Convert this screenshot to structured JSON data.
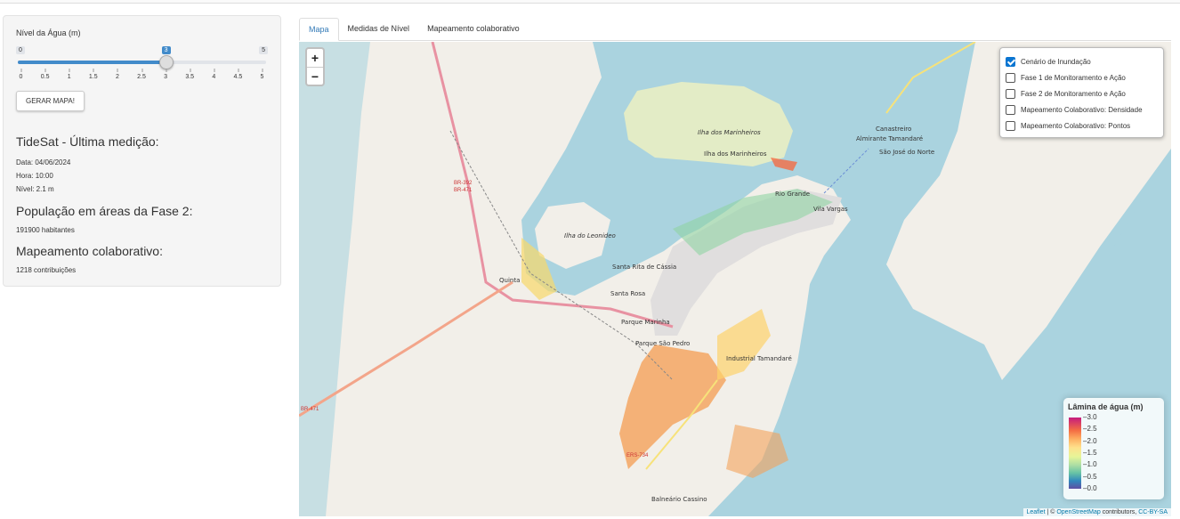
{
  "sidebar": {
    "slider": {
      "label": "Nível da Água (m)",
      "min": "0",
      "max": "5",
      "value": "3",
      "value_num": 3,
      "max_num": 5,
      "ticks": [
        "0",
        "0.5",
        "1",
        "1.5",
        "2",
        "2.5",
        "3",
        "3.5",
        "4",
        "4.5",
        "5"
      ]
    },
    "button_label": "GERAR MAPA!",
    "tidesat": {
      "title": "TideSat - Última medição:",
      "date": "Data: 04/06/2024",
      "hour": "Hora: 10:00",
      "level": "Nível: 2.1 m"
    },
    "population": {
      "title": "População em áreas da Fase 2:",
      "value": "191900 habitantes"
    },
    "collab": {
      "title": "Mapeamento colaborativo:",
      "value": "1218 contribuições"
    }
  },
  "tabs": [
    "Mapa",
    "Medidas de Nível",
    "Mapeamento colaborativo"
  ],
  "active_tab": 0,
  "map": {
    "zoom_in": "+",
    "zoom_out": "−",
    "layers": [
      {
        "label": "Cenário de Inundação",
        "checked": true
      },
      {
        "label": "Fase 1 de Monitoramento e Ação",
        "checked": false
      },
      {
        "label": "Fase 2 de Monitoramento e Ação",
        "checked": false
      },
      {
        "label": "Mapeamento Colaborativo: Densidade",
        "checked": false
      },
      {
        "label": "Mapeamento Colaborativo: Pontos",
        "checked": false
      }
    ],
    "legend": {
      "title": "Lâmina de água (m)",
      "ticks": [
        "3.0",
        "2.5",
        "2.0",
        "1.5",
        "1.0",
        "0.5",
        "0.0"
      ]
    },
    "attribution": {
      "leaflet": "Leaflet",
      "sep": " | © ",
      "osm": "OpenStreetMap",
      "contrib": " contributors, ",
      "license": "CC-BY-SA"
    },
    "labels": {
      "ilha_marinheiros": "Ilha dos Marinheiros",
      "ilha_marinheiros_sub": "Ilha dos Marinheiros",
      "ilha_leonideo": "Ilha do Leonideo",
      "santa_rita": "Santa Rita de Cássia",
      "santa_rosa": "Santa Rosa",
      "parque_marinha": "Parque Marinha",
      "parque_sao_pedro": "Parque São Pedro",
      "industrial": "Industrial Tamandaré",
      "quinta": "Quinta",
      "rio_grande": "Rio Grande",
      "vila_vargas": "Vila Vargas",
      "canastreiro": "Canastreiro",
      "almirante": "Almirante Tamandaré",
      "sao_jose": "São José do Norte",
      "balneario": "Balneário Cassino",
      "br392": "BR-392",
      "br471": "BR-471",
      "br471b": "BR-471",
      "ers734": "ERS-734"
    }
  }
}
